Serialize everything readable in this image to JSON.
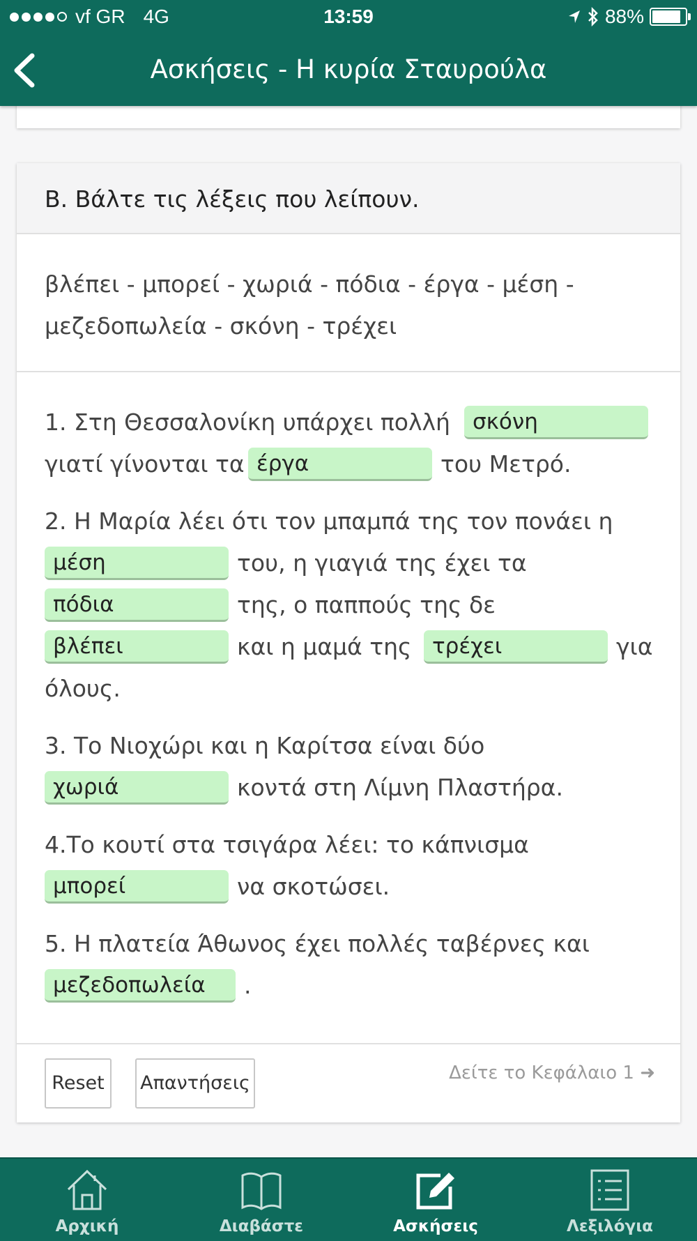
{
  "status_bar": {
    "carrier": "vf GR",
    "network": "4G",
    "time": "13:59",
    "battery": "88%",
    "battery_level": 0.88
  },
  "nav": {
    "title": "Ασκήσεις - Η κυρία Σταυρούλα",
    "back_icon": "chevron-left-icon"
  },
  "exercise": {
    "title": "B. Βάλτε τις λέξεις που λείπουν.",
    "word_bank_line1": "βλέπει - μπορεί - χωριά - πόδια - έργα - μέση -",
    "word_bank_line2": "μεζεδοπωλεία - σκόνη - τρέχει",
    "q1": {
      "a": "1. Στη Θεσσαλονίκη υπάρχει πολλή",
      "blank1": "σκόνη",
      "b": "γιατί γίνονται τα",
      "blank2": "έργα",
      "c": "του Μετρό."
    },
    "q2": {
      "a": "2. Η Μαρία λέει ότι τον μπαμπά της τον πονάει η",
      "blank1": "μέση",
      "b": "του, η γιαγιά της έχει τα",
      "blank2": "πόδια",
      "c": "της, ο παππούς της δε",
      "blank3": "βλέπει",
      "d": "και η μαμά της",
      "blank4": "τρέχει",
      "e": "για",
      "f": "όλους."
    },
    "q3": {
      "a": "3. Το Νιοχώρι και η Καρίτσα είναι δύο",
      "blank1": "χωριά",
      "b": "κοντά στη Λίμνη Πλαστήρα."
    },
    "q4": {
      "a": "4.Το κουτί στα τσιγάρα λέει: το κάπνισμα",
      "blank1": "μπορεί",
      "b": "να σκοτώσει."
    },
    "q5": {
      "a": "5. Η πλατεία Άθωνος έχει πολλές ταβέρνες και",
      "blank1": "μεζεδοπωλεία",
      "b": "."
    }
  },
  "footer": {
    "reset_label": "Reset",
    "answers_label": "Απαντήσεις",
    "chapter_link": "Δείτε το Κεφάλαιο 1 ➜"
  },
  "tabs": [
    {
      "label": "Αρχική",
      "icon": "home-icon"
    },
    {
      "label": "Διαβάστε",
      "icon": "book-icon"
    },
    {
      "label": "Ασκήσεις",
      "icon": "edit-icon",
      "active": true
    },
    {
      "label": "Λεξιλόγια",
      "icon": "list-icon"
    }
  ],
  "colors": {
    "brand": "#0e6b5c",
    "blank_fill": "#c8f5c8"
  }
}
